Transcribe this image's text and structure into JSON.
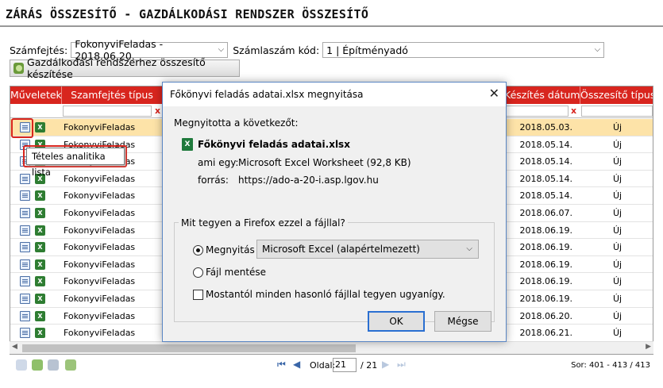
{
  "page": {
    "title": "ZÁRÁS ÖSSZESÍTŐ - GAZDÁLKODÁSI RENDSZER ÖSSZESÍTŐ"
  },
  "filters": {
    "szamfejtes_label": "Számfejtés:",
    "szamfejtes_value": "FokonyviFeladas - 2018.06.20.",
    "szamlaszam_label": "Számlaszám kód:",
    "szamlaszam_value": "1 | Építményadó",
    "generate_button": "Gazdálkodási rendszerhez összesítő készítése"
  },
  "grid": {
    "columns": [
      "Műveletek",
      "Szamfejtés típus",
      "Készítés dátum",
      "Összesítő típus"
    ],
    "filter_clear": "x",
    "rows": [
      {
        "tipus": "FokonyviFeladas",
        "datum": "2018.05.03.",
        "osszesito": "Új",
        "selected": true
      },
      {
        "tipus": "FokonyviFeladas",
        "datum": "2018.05.14.",
        "osszesito": "Új"
      },
      {
        "tipus": "FokonyviFeladas",
        "datum": "2018.05.14.",
        "osszesito": "Új"
      },
      {
        "tipus": "FokonyviFeladas",
        "datum": "2018.05.14.",
        "osszesito": "Új"
      },
      {
        "tipus": "FokonyviFeladas",
        "datum": "2018.05.14.",
        "osszesito": "Új"
      },
      {
        "tipus": "FokonyviFeladas",
        "datum": "2018.06.07.",
        "osszesito": "Új"
      },
      {
        "tipus": "FokonyviFeladas",
        "datum": "2018.06.19.",
        "osszesito": "Új"
      },
      {
        "tipus": "FokonyviFeladas",
        "datum": "2018.06.19.",
        "osszesito": "Új"
      },
      {
        "tipus": "FokonyviFeladas",
        "datum": "2018.06.19.",
        "osszesito": "Új"
      },
      {
        "tipus": "FokonyviFeladas",
        "datum": "2018.06.19.",
        "osszesito": "Új"
      },
      {
        "tipus": "FokonyviFeladas",
        "datum": "2018.06.19.",
        "osszesito": "Új"
      },
      {
        "tipus": "FokonyviFeladas",
        "datum": "2018.06.20.",
        "osszesito": "Új"
      },
      {
        "tipus": "FokonyviFeladas",
        "datum": "2018.06.21.",
        "osszesito": "Új"
      }
    ],
    "tooltip": "Tételes analitika lista"
  },
  "pager": {
    "page_label": "Oldal:",
    "current_page": "21",
    "total_pages": "/ 21",
    "summary": "Sor: 401 - 413 / 413"
  },
  "dialog": {
    "title": "Főkönyvi feladás adatai.xlsx megnyitása",
    "opened_label": "Megnyitotta a következőt:",
    "filename": "Főkönyvi feladás adatai.xlsx",
    "type_label": "ami egy:",
    "type_value": "Microsoft Excel Worksheet (92,8 KB)",
    "source_label": "forrás:",
    "source_value": "https://ado-a-20-i.asp.lgov.hu",
    "question": "Mit tegyen a Firefox ezzel a fájllal?",
    "open_with_label": "Megnyitás",
    "open_with_app": "Microsoft Excel (alapértelmezett)",
    "save_label": "Fájl mentése",
    "remember_label": "Mostantól minden hasonló fájllal tegyen ugyanígy.",
    "ok_label": "OK",
    "cancel_label": "Mégse"
  },
  "colors": {
    "header_red": "#d8251e",
    "selected_row": "#fde3a8",
    "dialog_border": "#5a86c4"
  }
}
